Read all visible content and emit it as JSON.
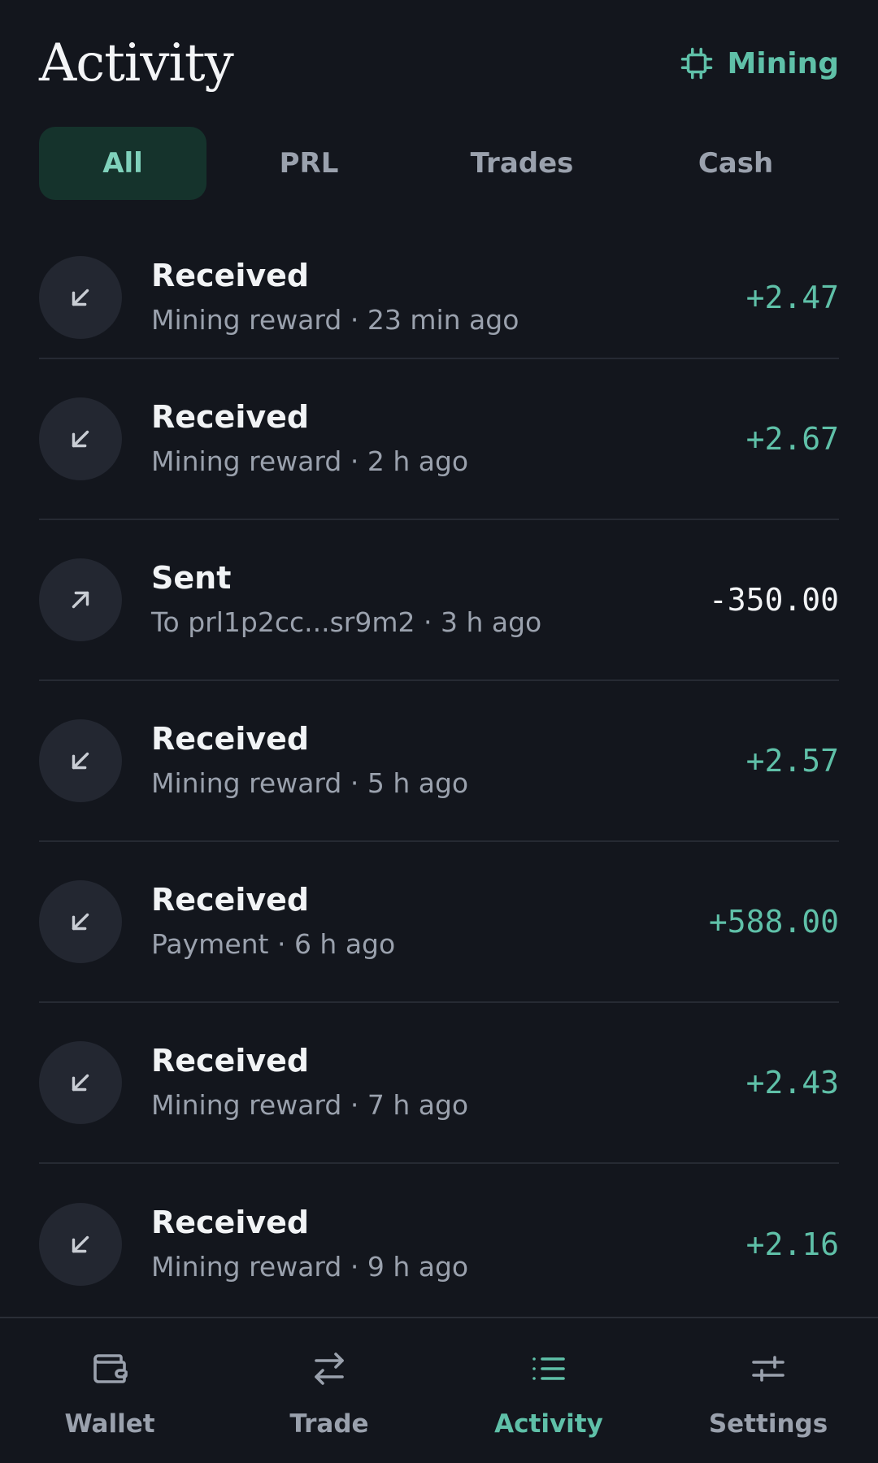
{
  "header": {
    "title": "Activity",
    "mining_label": "Mining"
  },
  "tabs": [
    {
      "label": "All",
      "active": true
    },
    {
      "label": "PRL",
      "active": false
    },
    {
      "label": "Trades",
      "active": false
    },
    {
      "label": "Cash",
      "active": false
    }
  ],
  "transactions": [
    {
      "title": "Received",
      "subtitle": "Mining reward · 23 min ago",
      "amount": "+2.47",
      "direction": "in"
    },
    {
      "title": "Received",
      "subtitle": "Mining reward · 2 h ago",
      "amount": "+2.67",
      "direction": "in"
    },
    {
      "title": "Sent",
      "subtitle": "To prl1p2cc...sr9m2 · 3 h ago",
      "amount": "-350.00",
      "direction": "out"
    },
    {
      "title": "Received",
      "subtitle": "Mining reward · 5 h ago",
      "amount": "+2.57",
      "direction": "in"
    },
    {
      "title": "Received",
      "subtitle": "Payment · 6 h ago",
      "amount": "+588.00",
      "direction": "in"
    },
    {
      "title": "Received",
      "subtitle": "Mining reward · 7 h ago",
      "amount": "+2.43",
      "direction": "in"
    },
    {
      "title": "Received",
      "subtitle": "Mining reward · 9 h ago",
      "amount": "+2.16",
      "direction": "in"
    }
  ],
  "nav": [
    {
      "label": "Wallet",
      "icon": "wallet-icon",
      "active": false
    },
    {
      "label": "Trade",
      "icon": "swap-icon",
      "active": false
    },
    {
      "label": "Activity",
      "icon": "list-icon",
      "active": true
    },
    {
      "label": "Settings",
      "icon": "sliders-icon",
      "active": false
    }
  ],
  "colors": {
    "background": "#13161d",
    "accent": "#5fc0a8",
    "active_tab_bg": "#15332c",
    "muted_text": "#9aa1ad"
  }
}
